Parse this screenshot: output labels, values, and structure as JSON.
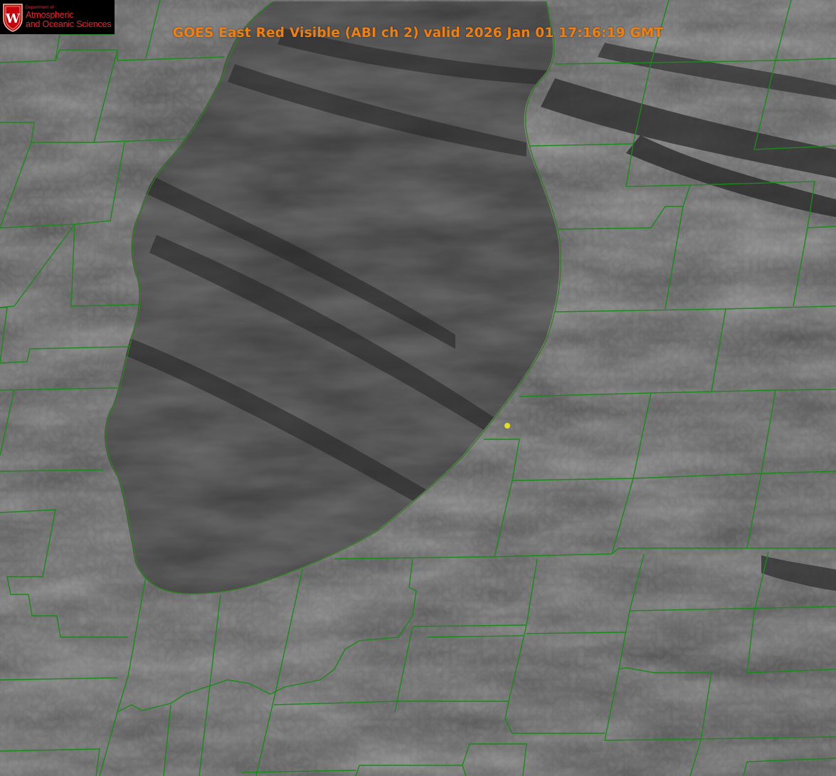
{
  "product": {
    "title": "GOES East Red Visible (ABI ch 2) valid 2026 Jan 01 17:16:19 GMT"
  },
  "logo": {
    "department_label": "Department of",
    "line1": "Atmospheric",
    "line2": "and Oceanic Sciences",
    "crest_letter": "W"
  },
  "map": {
    "imagery": "grayscale visible satellite imagery, cloud streets over a large lake",
    "county_border_color": "#1a8a1a",
    "shoreline_color": "#d03a2a",
    "title_color": "#f07f10",
    "site_marker_color": "#e0e020",
    "site_marker_icon": "site-marker-icon"
  }
}
